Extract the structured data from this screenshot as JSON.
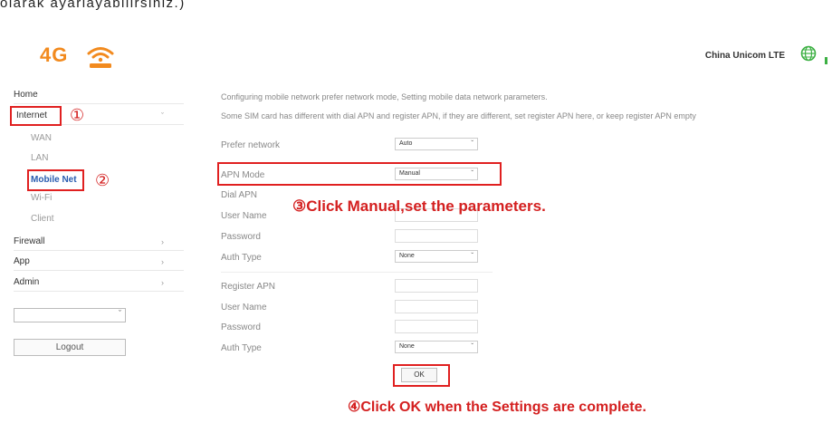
{
  "caption": "olarak ayarlayabilirsiniz.)",
  "header": {
    "logo_text": "4G",
    "logo_icon": "wifi-router-icon",
    "carrier": "China Unicom LTE",
    "globe_icon": "globe-icon",
    "accent_color": "#f28a1e"
  },
  "sidebar": {
    "items": [
      {
        "label": "Home"
      },
      {
        "label": "Internet",
        "chevron": "ˇ"
      },
      {
        "label": "WAN"
      },
      {
        "label": "LAN"
      },
      {
        "label": "Mobile Net"
      },
      {
        "label": "Wi-Fi"
      },
      {
        "label": "Client"
      },
      {
        "label": "Firewall",
        "chevron": "›"
      },
      {
        "label": "App",
        "chevron": "›"
      },
      {
        "label": "Admin",
        "chevron": "›"
      }
    ],
    "language_select": {
      "value": "",
      "arrow": "ˇ"
    },
    "logout_label": "Logout"
  },
  "content": {
    "desc1": "Configuring mobile network prefer network mode, Setting mobile data network parameters.",
    "desc2": "Some SIM card has different with dial APN and register APN, if they are different, set register APN here, or keep register APN empty",
    "prefer_network": {
      "label": "Prefer network",
      "value": "Auto"
    },
    "apn_mode": {
      "label": "APN Mode",
      "value": "Manual"
    },
    "dial_apn": {
      "label": "Dial APN"
    },
    "user_name_1": {
      "label": "User Name"
    },
    "password_1": {
      "label": "Password"
    },
    "auth_type_1": {
      "label": "Auth Type",
      "value": "None"
    },
    "register_apn": {
      "label": "Register APN"
    },
    "user_name_2": {
      "label": "User Name"
    },
    "password_2": {
      "label": "Password"
    },
    "auth_type_2": {
      "label": "Auth Type",
      "value": "None"
    },
    "ok_label": "OK",
    "select_arrow": "ˇ"
  },
  "annotations": {
    "step1": "①",
    "step2": "②",
    "step3": "③Click Manual,set the parameters.",
    "step4": "④Click OK when the Settings are complete.",
    "highlight_color": "#e02020"
  }
}
